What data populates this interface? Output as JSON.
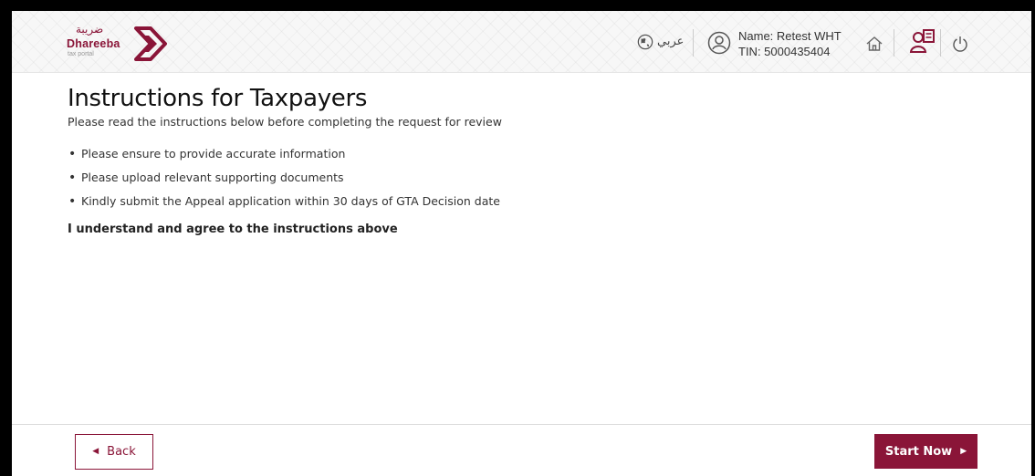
{
  "header": {
    "logo": {
      "arabic_text": "ضريبة",
      "name": "Dhareeba",
      "tagline": "tax portal",
      "brand_color": "#8a1538"
    },
    "language_label": "عربي",
    "user": {
      "name": "Name: Retest WHT",
      "tin": "TIN: 5000435404"
    },
    "icons": [
      "globe-icon",
      "user-icon",
      "home-icon",
      "switch-account-icon",
      "power-icon"
    ]
  },
  "main": {
    "title": "Instructions for Taxpayers",
    "subtitle": "Please read the instructions below before completing the request for review",
    "instructions": [
      "Please ensure to provide accurate information",
      "Please upload relevant supporting documents",
      "Kindly submit the Appeal application within 30 days of GTA Decision date"
    ],
    "agreement": "I understand and agree to the instructions above"
  },
  "footer": {
    "back_label": "Back",
    "start_label": "Start Now"
  }
}
